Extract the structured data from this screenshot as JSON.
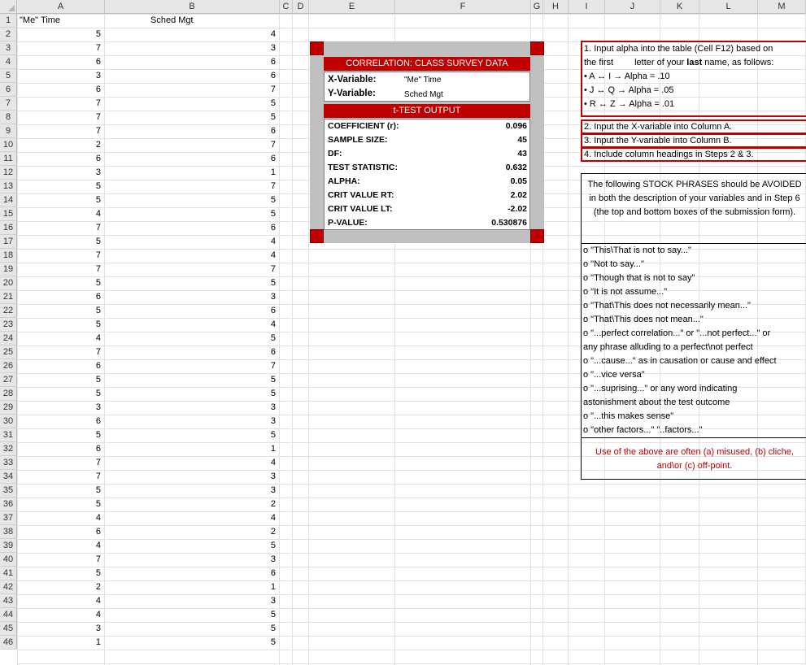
{
  "sheet": {
    "columns": [
      "A",
      "B",
      "C",
      "D",
      "E",
      "F",
      "G",
      "H",
      "I",
      "J",
      "K",
      "L",
      "M"
    ],
    "rows": [
      "1",
      "2",
      "3",
      "4",
      "5",
      "6",
      "7",
      "8",
      "9",
      "10",
      "11",
      "12",
      "13",
      "14",
      "15",
      "16",
      "17",
      "18",
      "19",
      "20",
      "21",
      "22",
      "23",
      "24",
      "25",
      "26",
      "27",
      "28",
      "29",
      "30",
      "31",
      "32",
      "33",
      "34",
      "35",
      "36",
      "37",
      "38",
      "39",
      "40",
      "41",
      "42",
      "43",
      "44",
      "45",
      "46"
    ],
    "header_a": "\"Me\" Time",
    "header_b": "Sched Mgt",
    "col_a": [
      "5",
      "7",
      "6",
      "3",
      "6",
      "7",
      "7",
      "7",
      "2",
      "6",
      "3",
      "5",
      "5",
      "4",
      "7",
      "5",
      "7",
      "7",
      "5",
      "6",
      "5",
      "5",
      "4",
      "7",
      "6",
      "5",
      "5",
      "3",
      "6",
      "5",
      "6",
      "7",
      "7",
      "5",
      "5",
      "4",
      "6",
      "4",
      "7",
      "5",
      "2",
      "4",
      "4",
      "3",
      "1"
    ],
    "col_b": [
      "4",
      "3",
      "6",
      "6",
      "7",
      "5",
      "5",
      "6",
      "7",
      "6",
      "1",
      "7",
      "5",
      "5",
      "6",
      "4",
      "4",
      "7",
      "5",
      "3",
      "6",
      "4",
      "5",
      "6",
      "7",
      "5",
      "5",
      "3",
      "3",
      "5",
      "1",
      "4",
      "3",
      "3",
      "2",
      "4",
      "2",
      "5",
      "3",
      "6",
      "1",
      "3",
      "5",
      "5",
      "5"
    ]
  },
  "correlation": {
    "title": "CORRELATION: CLASS SURVEY DATA",
    "x_label": "X-Variable:",
    "x_value": "\"Me\" Time",
    "y_label": "Y-Variable:",
    "y_value": "Sched Mgt",
    "output_title": "t-TEST OUTPUT",
    "stats": [
      {
        "label": "COEFFICIENT (r):",
        "value": "0.096"
      },
      {
        "label": "SAMPLE SIZE:",
        "value": "45"
      },
      {
        "label": "DF:",
        "value": "43"
      },
      {
        "label": "TEST STATISTIC:",
        "value": "0.632"
      },
      {
        "label": "ALPHA:",
        "value": "0.05"
      },
      {
        "label": "CRIT VALUE RT:",
        "value": "2.02"
      },
      {
        "label": "CRIT VALUE LT:",
        "value": "-2.02"
      },
      {
        "label": "P-VALUE:",
        "value": "0.530876"
      }
    ],
    "accent_color": "#c00000"
  },
  "instructions": {
    "step1_line1": "1. Input alpha into the table (Cell F12) based on",
    "step1_line2a": "the first",
    "step1_line2b": "letter of your ",
    "step1_line2c": "last",
    "step1_line2d": " name, as follows:",
    "step1_rules": [
      "• A ↔ I  → Alpha = .10",
      "• J ↔ Q  → Alpha = .05",
      "• R ↔ Z  → Alpha = .01"
    ],
    "step2": "2. Input the X-variable into Column A.",
    "step3": "3. Input the Y-variable into Column B.",
    "step4": "4. Include column headings in Steps 2 & 3."
  },
  "stock": {
    "heading": "The following STOCK PHRASES should be AVOIDED in both the description of your variables and in Step 6 (the top and bottom boxes of the submission form).",
    "items": [
      "o  \"This\\That is not to say...\"",
      "o  \"Not to say...\"",
      "o  \"Though that is not to say\"",
      "o  \"It is not assume...\"",
      "o  \"That\\This does not necessarily mean...\"",
      "o  \"That\\This does not mean...\"",
      "o  \"...perfect correlation...\" or \"...not perfect...\" or",
      "any phrase alluding to a perfect\\not perfect",
      "o  \"...cause...\" as in causation or cause and effect",
      "o  \"...vice versa\"",
      "o  \"...suprising...\"  or any word indicating",
      "astonishment about the test outcome",
      "o  \"...this makes sense\"",
      "o  \"other factors...\" \"..factors...\""
    ],
    "footer": "Use of the above are often (a) misused, (b) cliche, and\\or (c) off-point."
  }
}
